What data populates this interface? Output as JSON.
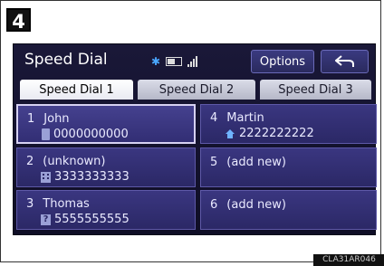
{
  "figure": {
    "step_number": "4",
    "reference_code": "CLA31AR046"
  },
  "header": {
    "title": "Speed Dial",
    "options_label": "Options"
  },
  "tabs": [
    {
      "label": "Speed Dial 1",
      "active": true
    },
    {
      "label": "Speed Dial 2",
      "active": false
    },
    {
      "label": "Speed Dial 3",
      "active": false
    }
  ],
  "slots": [
    {
      "number": "1",
      "name": "John",
      "phone": "0000000000",
      "icon": "mobile-phone-icon",
      "selected": true
    },
    {
      "number": "4",
      "name": "Martin",
      "phone": "2222222222",
      "icon": "home-icon",
      "selected": false
    },
    {
      "number": "2",
      "name": "(unknown)",
      "phone": "3333333333",
      "icon": "office-icon",
      "selected": false
    },
    {
      "number": "5",
      "name": "(add new)",
      "phone": "",
      "icon": "",
      "selected": false
    },
    {
      "number": "3",
      "name": "Thomas",
      "phone": "5555555555",
      "icon": "other-phone-icon",
      "selected": false
    },
    {
      "number": "6",
      "name": "(add new)",
      "phone": "",
      "icon": "",
      "selected": false
    }
  ],
  "colors": {
    "screen_bg": "#14132e",
    "tile_bg": "#352f78",
    "tab_active": "#ffffff"
  }
}
